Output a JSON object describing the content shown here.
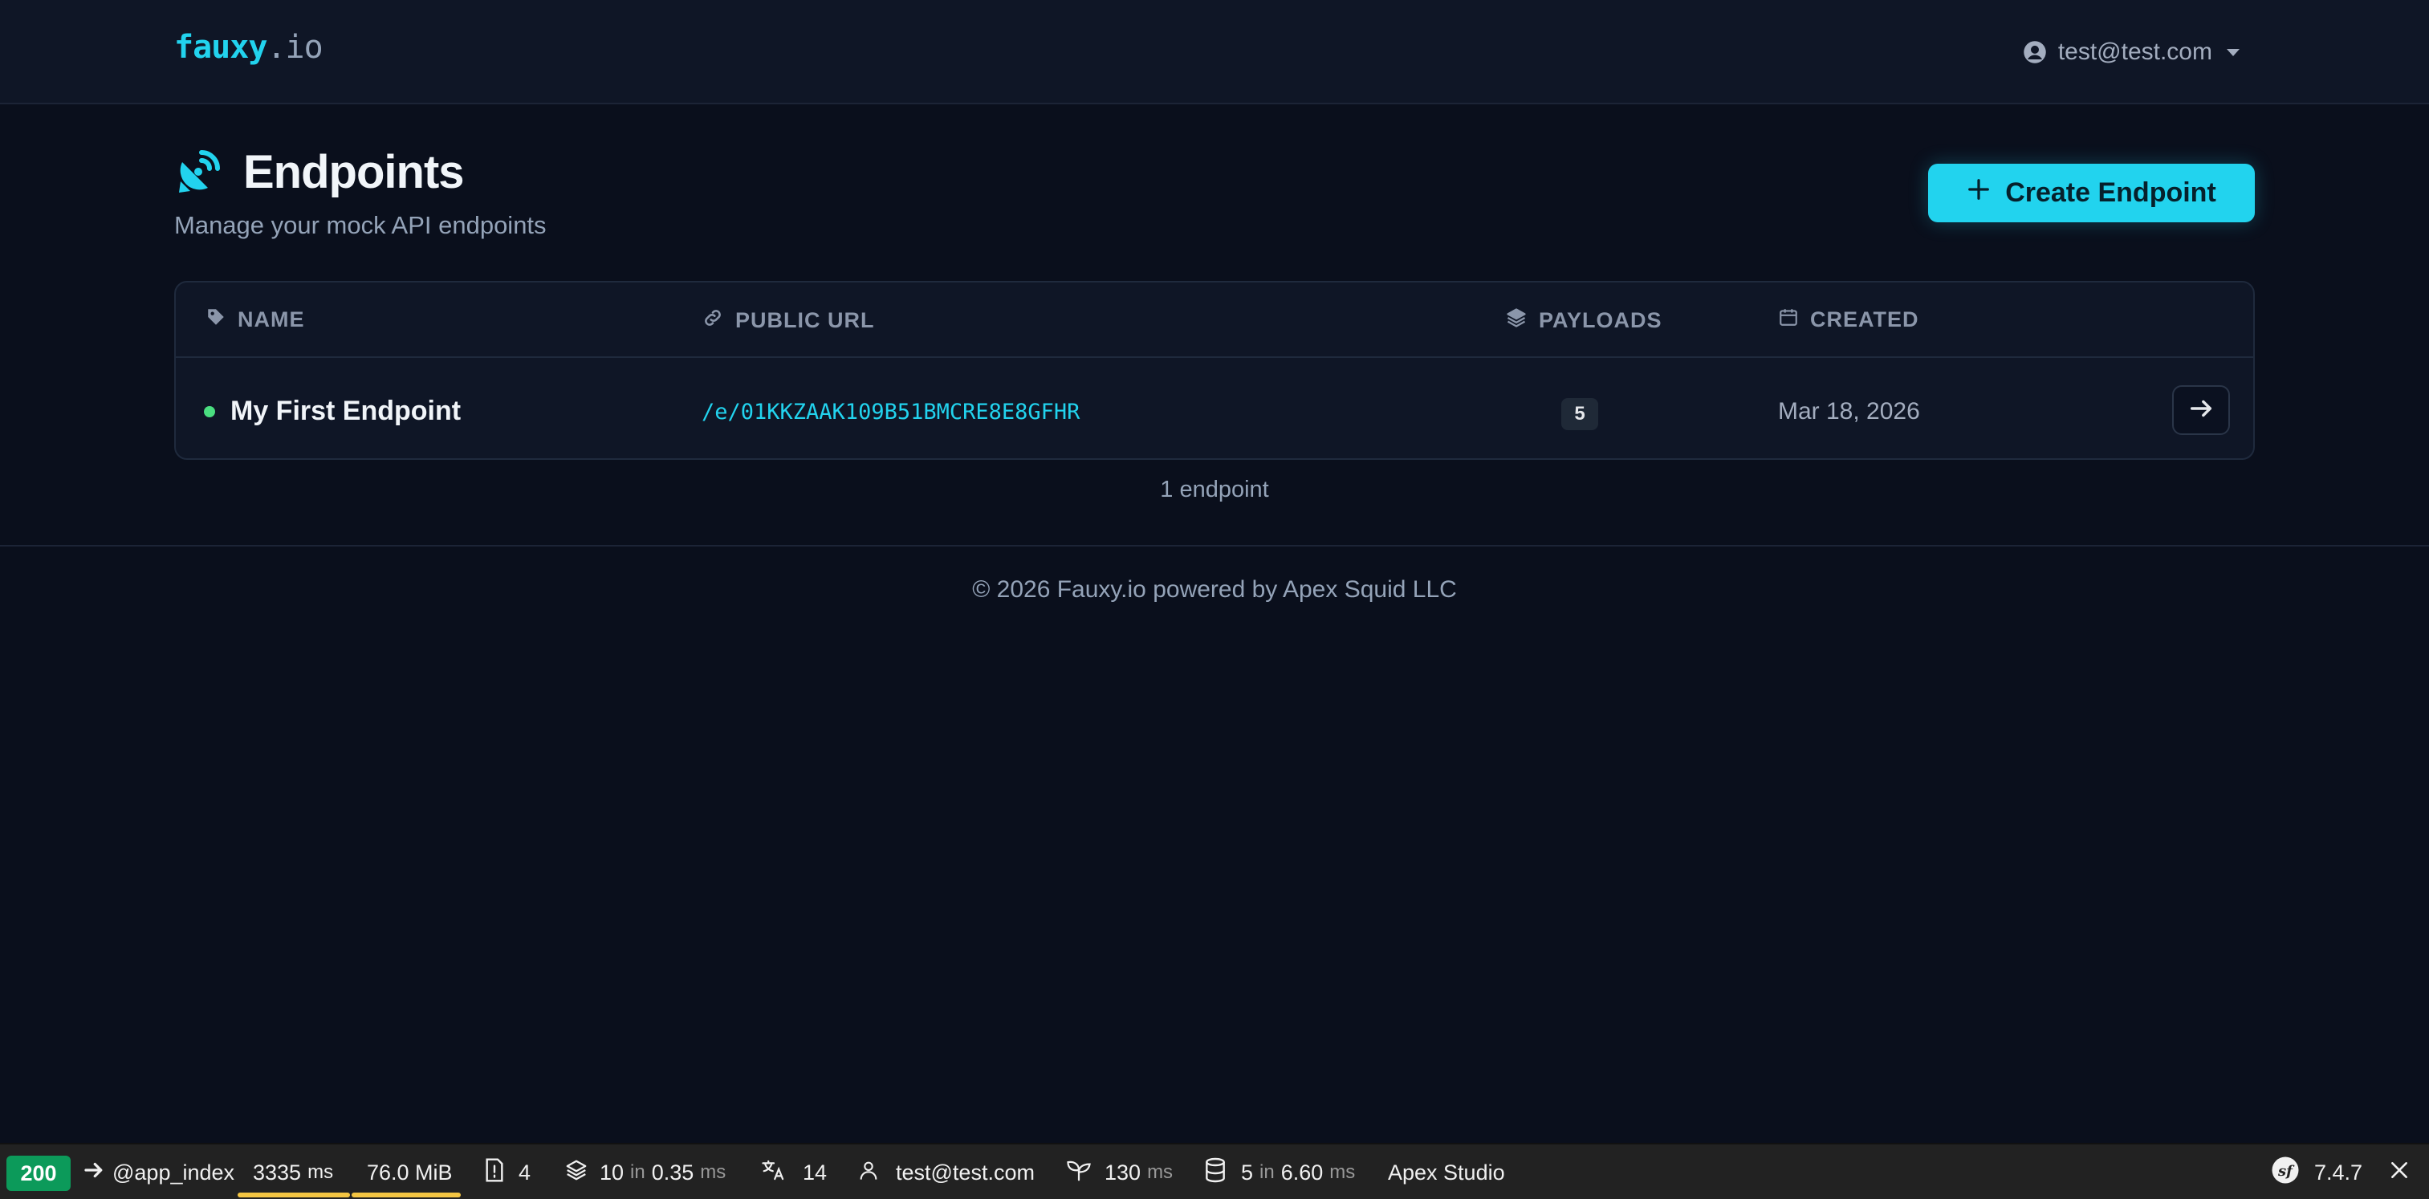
{
  "header": {
    "logo_main": "fauxy",
    "logo_suffix": ".io",
    "user_email": "test@test.com"
  },
  "page": {
    "title": "Endpoints",
    "subtitle": "Manage your mock API endpoints",
    "create_button_label": "Create Endpoint"
  },
  "table": {
    "columns": {
      "name": "NAME",
      "public_url": "PUBLIC URL",
      "payloads": "PAYLOADS",
      "created": "CREATED"
    },
    "rows": [
      {
        "name": "My First Endpoint",
        "url": "/e/01KKZAAK109B51BMCRE8E8GFHR",
        "payloads": "5",
        "created": "Mar 18, 2026",
        "status_color": "#4ade80"
      }
    ],
    "count_label": "1 endpoint"
  },
  "footer": {
    "text": "© 2026 Fauxy.io powered by Apex Squid LLC"
  },
  "debug_toolbar": {
    "status_code": "200",
    "route": "@app_index",
    "time_value": "3335",
    "time_unit": "ms",
    "memory": "76.0 MiB",
    "logs_count": "4",
    "cache_count": "10",
    "cache_in": "in",
    "cache_time": "0.35",
    "cache_unit": "ms",
    "translation_count": "14",
    "user": "test@test.com",
    "twig_time": "130",
    "twig_unit": "ms",
    "db_count": "5",
    "db_in": "in",
    "db_time": "6.60",
    "db_unit": "ms",
    "project": "Apex Studio",
    "version": "7.4.7"
  },
  "colors": {
    "accent": "#22d3ee",
    "background": "#0a0f1c",
    "status_ok": "#0c9a5a"
  }
}
